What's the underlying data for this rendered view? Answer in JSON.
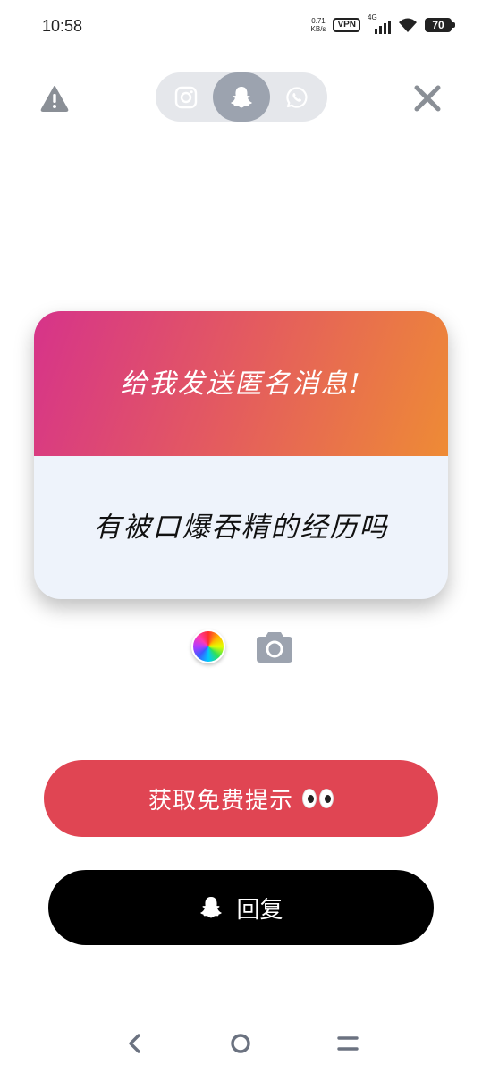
{
  "status_bar": {
    "time": "10:58",
    "net_speed_value": "0.71",
    "net_speed_unit": "KB/s",
    "vpn": "VPN",
    "network": "4G",
    "battery": "70"
  },
  "tabs": {
    "items": [
      {
        "name": "instagram",
        "icon": "instagram-icon",
        "selected": false
      },
      {
        "name": "snapchat",
        "icon": "snapchat-ghost-icon",
        "selected": true
      },
      {
        "name": "whatsapp",
        "icon": "whatsapp-icon",
        "selected": false
      }
    ]
  },
  "card": {
    "title": "给我发送匿名消息!",
    "message": "有被口爆吞精的经历吗",
    "gradient_colors": [
      "#d6338a",
      "#e45c5e",
      "#ee8b35"
    ]
  },
  "buttons": {
    "hint_label": "获取免费提示",
    "hint_color": "#e04553",
    "reply_label": "回复",
    "reply_color": "#000000"
  },
  "icons": {
    "warning": "warning-icon",
    "close": "close-icon",
    "color": "color-wheel-icon",
    "camera": "camera-icon",
    "eyes": "eyes-emoji-icon"
  }
}
